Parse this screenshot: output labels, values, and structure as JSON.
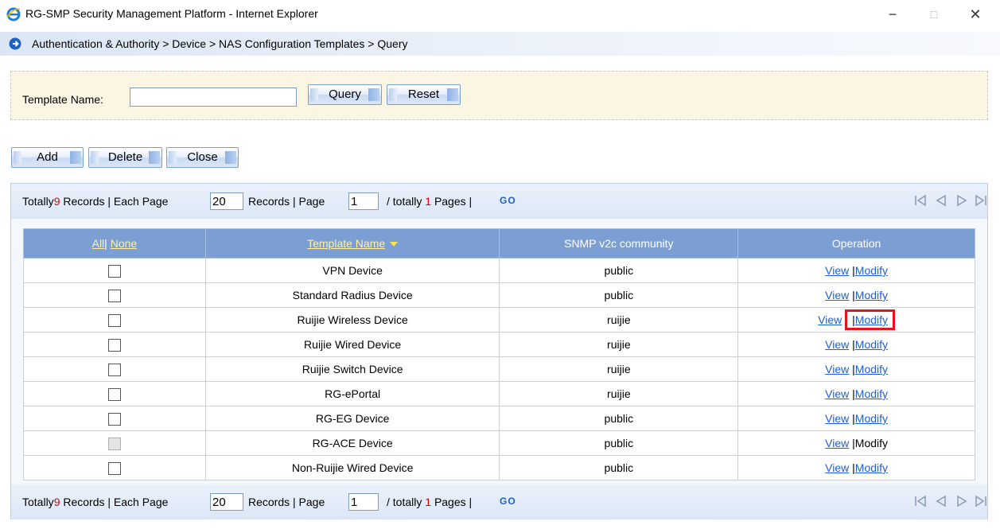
{
  "window": {
    "title": "RG-SMP Security Management Platform - Internet Explorer",
    "min_glyph": "−",
    "max_glyph": "□",
    "close_glyph": "✕"
  },
  "breadcrumb": "Authentication & Authority > Device > NAS Configuration Templates > Query",
  "query": {
    "label": "Template Name:",
    "value": "",
    "query_button": "Query",
    "reset_button": "Reset"
  },
  "actions": {
    "add": "Add",
    "delete": "Delete",
    "close": "Close"
  },
  "pager": {
    "totally": "Totally",
    "total_records": "9",
    "records_each_page": "Records | Each Page",
    "page_size": "20",
    "records_page": "Records | Page",
    "page": "1",
    "slash_totally": "/ totally",
    "total_pages": "1",
    "pages": "Pages |",
    "go": "GO"
  },
  "table": {
    "header_all": "All",
    "header_sep": "|",
    "header_none": "None",
    "header_template": "Template Name",
    "header_community": "SNMP v2c community",
    "header_operation": "Operation",
    "view_label": "View",
    "sep": "|",
    "modify_label": "Modify",
    "rows": [
      {
        "name": "VPN Device",
        "community": "public"
      },
      {
        "name": "Standard Radius Device",
        "community": "public"
      },
      {
        "name": "Ruijie Wireless Device",
        "community": "ruijie"
      },
      {
        "name": "Ruijie Wired Device",
        "community": "ruijie"
      },
      {
        "name": "Ruijie Switch Device",
        "community": "ruijie"
      },
      {
        "name": "RG-ePortal",
        "community": "ruijie"
      },
      {
        "name": "RG-EG Device",
        "community": "public"
      },
      {
        "name": "RG-ACE Device",
        "community": "public"
      },
      {
        "name": "Non-Ruijie Wired Device",
        "community": "public"
      }
    ]
  },
  "colors": {
    "header_bg": "#7b9fd3",
    "link": "#1e5ed6",
    "highlight": "#e8131a",
    "query_bg": "#fbf6e4"
  }
}
